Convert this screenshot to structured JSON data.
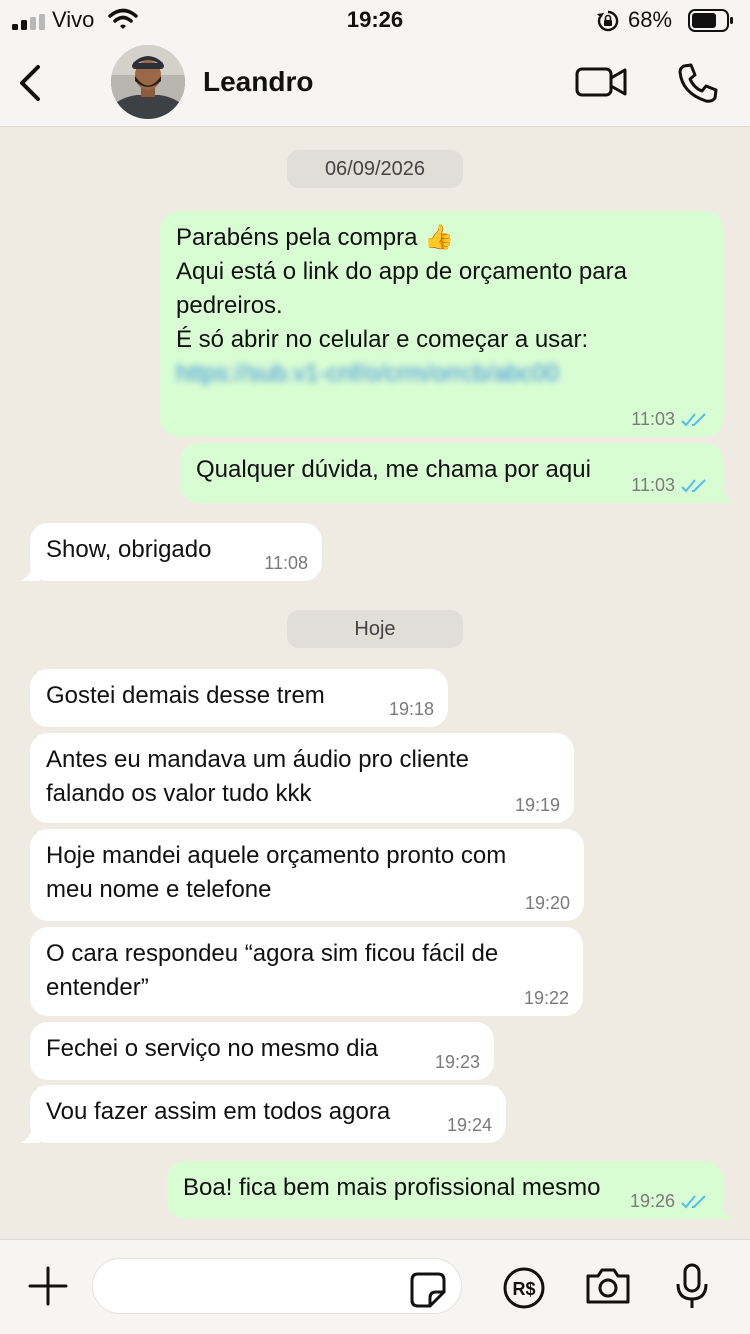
{
  "status_bar": {
    "carrier": "Vivo",
    "time": "19:26",
    "battery": "68%"
  },
  "header": {
    "contact_name": "Leandro"
  },
  "chat": {
    "date_1": "06/09/2026",
    "date_2": "Hoje",
    "messages": [
      {
        "lines": [
          "Parabéns pela compra 👍",
          "Aqui está o link do app de orçamento para",
          "pedreiros.",
          "É só abrir no celular e começar a usar:"
        ],
        "link": "https://sub.v1-cnf/o/crm/orrcb/abc00",
        "time": "11:03"
      },
      {
        "text": "Qualquer dúvida, me chama por aqui",
        "time": "11:03"
      },
      {
        "text": "Show, obrigado",
        "time": "11:08"
      },
      {
        "text": "Gostei demais desse trem",
        "time": "19:18"
      },
      {
        "lines": [
          "Antes eu mandava um áudio pro cliente",
          "falando os valor tudo kkk"
        ],
        "time": "19:19"
      },
      {
        "lines": [
          "Hoje mandei aquele orçamento pronto com",
          "meu nome e telefone"
        ],
        "time": "19:20"
      },
      {
        "lines": [
          "O cara respondeu “agora sim ficou fácil de",
          "entender”"
        ],
        "time": "19:22"
      },
      {
        "text": "Fechei o serviço no mesmo dia",
        "time": "19:23"
      },
      {
        "text": "Vou fazer assim em todos agora",
        "time": "19:24"
      },
      {
        "text": "Boa! fica bem mais profissional mesmo",
        "time": "19:26"
      }
    ]
  },
  "colors": {
    "incoming": "#ffffff",
    "outgoing": "#d9fdd3",
    "read_ticks": "#53bdeb",
    "background": "#efeae2"
  },
  "icons": [
    "signal-icon",
    "wifi-icon",
    "rotation-lock-icon",
    "battery-icon",
    "back-icon",
    "video-call-icon",
    "phone-icon",
    "plus-icon",
    "sticker-icon",
    "currency-icon",
    "camera-icon",
    "microphone-icon"
  ]
}
